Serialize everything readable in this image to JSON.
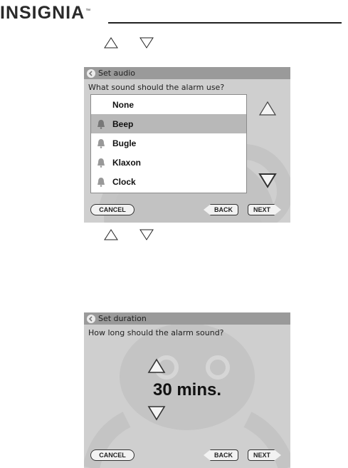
{
  "brand": {
    "name": "INSIGNIA",
    "tm": "™"
  },
  "screen_audio": {
    "title": "Set audio",
    "question": "What sound should the alarm use?",
    "items": [
      {
        "label": "None",
        "icon": "none",
        "selected": false
      },
      {
        "label": "Beep",
        "icon": "bell-icon",
        "selected": true
      },
      {
        "label": "Bugle",
        "icon": "bell-icon",
        "selected": false
      },
      {
        "label": "Klaxon",
        "icon": "bell-icon",
        "selected": false
      },
      {
        "label": "Clock",
        "icon": "bell-icon",
        "selected": false
      }
    ],
    "buttons": {
      "cancel": "CANCEL",
      "back": "BACK",
      "next": "NEXT"
    }
  },
  "screen_duration": {
    "title": "Set duration",
    "question": "How long should the alarm sound?",
    "value": "30 mins.",
    "buttons": {
      "cancel": "CANCEL",
      "back": "BACK",
      "next": "NEXT"
    }
  },
  "colors": {
    "screen_bg": "#cfcfcf",
    "title_bar": "#9a9a9a",
    "selected_row": "#b8b8b8"
  }
}
